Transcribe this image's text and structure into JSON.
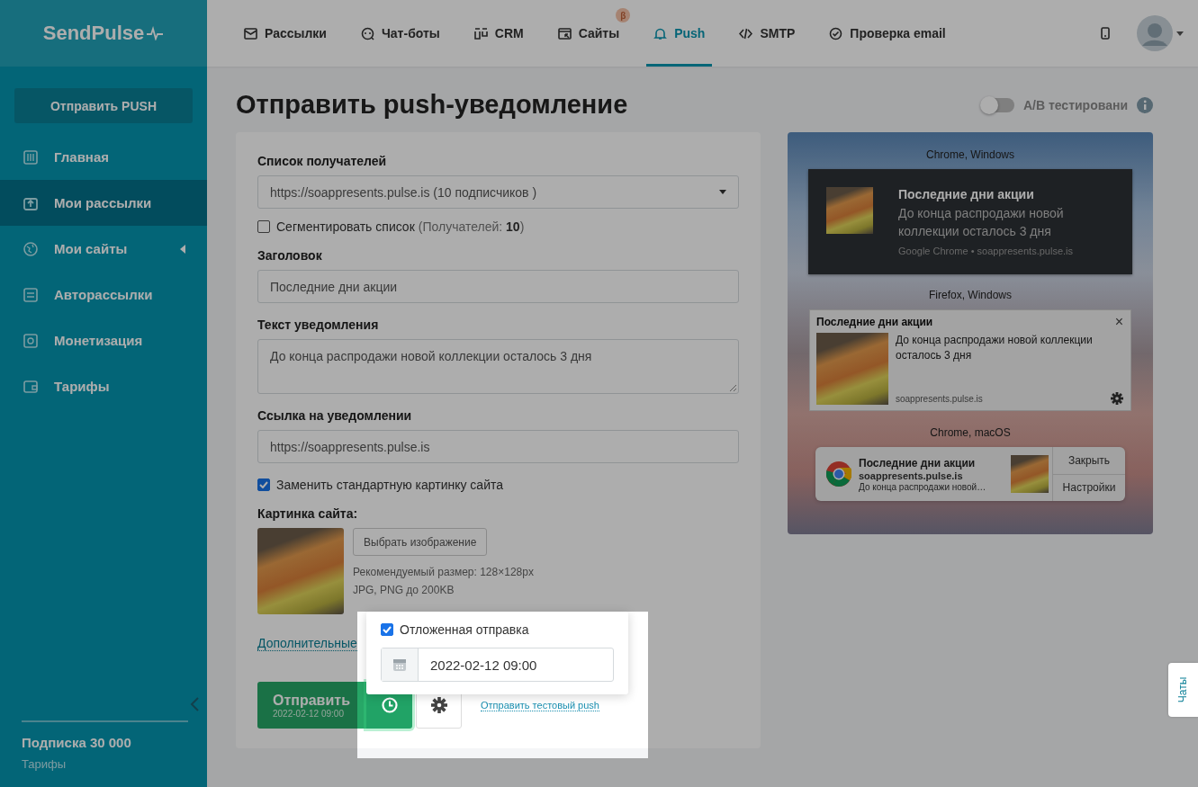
{
  "logo": {
    "text": "SendPulse"
  },
  "nav": [
    {
      "label": "Рассылки",
      "selected": false
    },
    {
      "label": "Чат-боты",
      "selected": false
    },
    {
      "label": "CRM",
      "selected": false
    },
    {
      "label": "Сайты",
      "selected": false,
      "badge": "β"
    },
    {
      "label": "Push",
      "selected": true
    },
    {
      "label": "SMTP",
      "selected": false
    },
    {
      "label": "Проверка email",
      "selected": false
    }
  ],
  "sidebar": {
    "primary_button": "Отправить PUSH",
    "items": [
      {
        "label": "Главная",
        "selected": false
      },
      {
        "label": "Мои рассылки",
        "selected": true
      },
      {
        "label": "Мои сайты",
        "selected": false,
        "expandable": true
      },
      {
        "label": "Авторассылки",
        "selected": false
      },
      {
        "label": "Монетизация",
        "selected": false
      },
      {
        "label": "Тарифы",
        "selected": false
      }
    ],
    "plan": "Подписка 30 000",
    "plan_link": "Тарифы"
  },
  "page_title": "Отправить push-уведомление",
  "ab_toggle": {
    "label": "А/В тестировани",
    "on": false
  },
  "form": {
    "recipients_label": "Список получателей",
    "recipients_value": "https://soappresents.pulse.is (10 подписчиков )",
    "segment": {
      "label": "Сегментировать список",
      "count": "(Получателей: **10**)",
      "checked": false
    },
    "title_label": "Заголовок",
    "title_value": "Последние дни акции",
    "text_label": "Текст уведомления",
    "text_value": "До конца распродажи новой коллекции осталось 3 дня",
    "link_label": "Ссылка на уведомлении",
    "link_value": "https://soappresents.pulse.is",
    "replace_image": {
      "label": "Заменить стандартную картинку сайта",
      "checked": true
    },
    "image_label": "Картинка сайта:",
    "choose_button": "Выбрать изображение",
    "hints": [
      "Рекомендуемый размер: 128×128px",
      "JPG, PNG до 200KB"
    ],
    "more_link": "Дополнительные",
    "send_button": {
      "label": "Отправить",
      "sub": "2022-02-12 09:00"
    },
    "test_link": "Отправить тестовый push"
  },
  "schedule_popup": {
    "label": "Отложенная отправка",
    "checked": true,
    "value": "2022-02-12 09:00"
  },
  "preview": {
    "sections": [
      {
        "kind": "chrome_windows",
        "caption": "Chrome, Windows",
        "title": "Последние дни акции",
        "body": "До конца распродажи новой коллекции осталось 3 дня",
        "source": "Google Chrome • soappresents.pulse.is"
      },
      {
        "kind": "firefox_windows",
        "caption": "Firefox, Windows",
        "title": "Последние дни акции",
        "body": "До конца распродажи новой коллекции осталось 3 дня",
        "source": "soappresents.pulse.is",
        "close": "×"
      },
      {
        "kind": "chrome_macos",
        "caption": "Chrome, macOS",
        "title": "Последние дни акции",
        "body": "До конца распродажи новой…",
        "source": "soappresents.pulse.is",
        "actions": [
          "Закрыть",
          "Настройки"
        ]
      }
    ]
  },
  "chat_tab": "Чаты"
}
